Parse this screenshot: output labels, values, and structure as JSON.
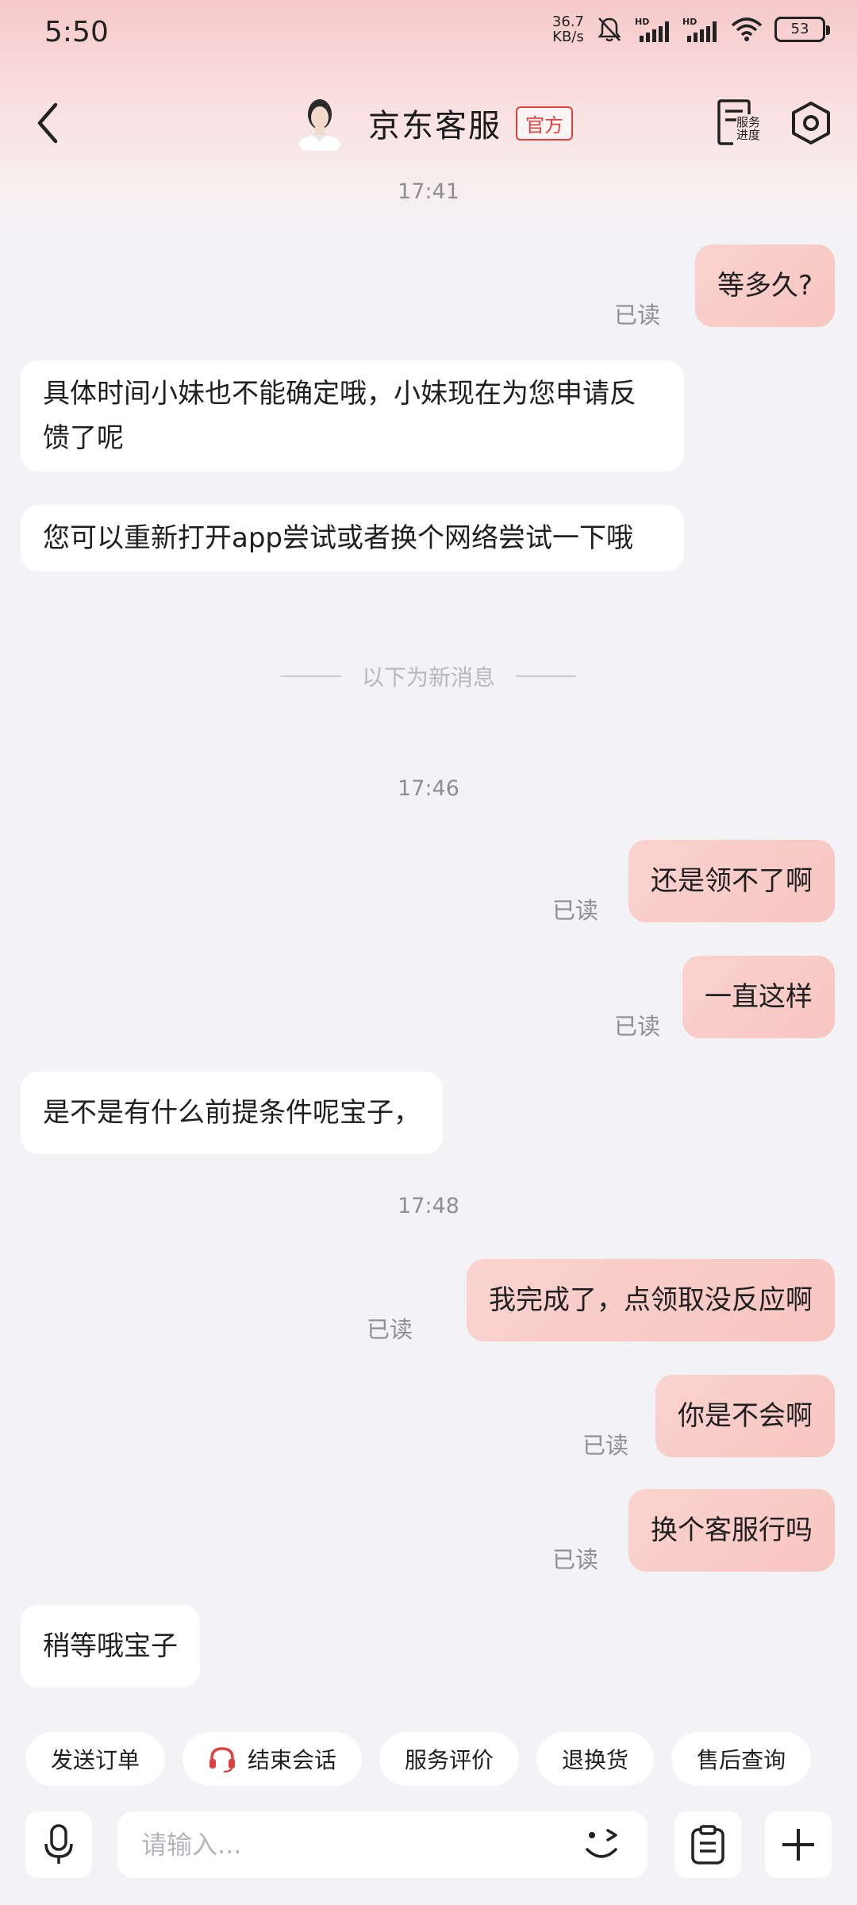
{
  "status_bar": {
    "time": "5:50",
    "net_speed_value": "36.7",
    "net_speed_unit": "KB/s",
    "battery": "53",
    "icons": [
      "mute-icon",
      "signal-hd-icon",
      "signal-hd-icon",
      "wifi-icon",
      "battery-icon"
    ]
  },
  "header": {
    "agent_name": "京东客服",
    "badge": "官方",
    "progress_label": "服务进度"
  },
  "chat": {
    "timestamps": [
      "17:41",
      "17:46",
      "17:48"
    ],
    "divider_text": "以下为新消息",
    "read_label": "已读",
    "messages": [
      {
        "from": "user",
        "text": "等多久?"
      },
      {
        "from": "agent",
        "text": "具体时间小妹也不能确定哦，小妹现在为您申请反馈了呢"
      },
      {
        "from": "agent",
        "text": "您可以重新打开app尝试或者换个网络尝试一下哦"
      },
      {
        "from": "user",
        "text": "还是领不了啊"
      },
      {
        "from": "user",
        "text": "一直这样"
      },
      {
        "from": "agent",
        "text": "是不是有什么前提条件呢宝子，"
      },
      {
        "from": "user",
        "text": "我完成了，点领取没反应啊"
      },
      {
        "from": "user",
        "text": "你是不会啊"
      },
      {
        "from": "user",
        "text": "换个客服行吗"
      },
      {
        "from": "agent",
        "text": "稍等哦宝子"
      }
    ]
  },
  "quick_actions": [
    "发送订单",
    "结束会话",
    "服务评价",
    "退换货",
    "售后查询"
  ],
  "input": {
    "placeholder": "请输入..."
  },
  "colors": {
    "accent_red": "#e0413f",
    "user_bubble": "#f8ccc8",
    "background": "#f2f2f7"
  }
}
